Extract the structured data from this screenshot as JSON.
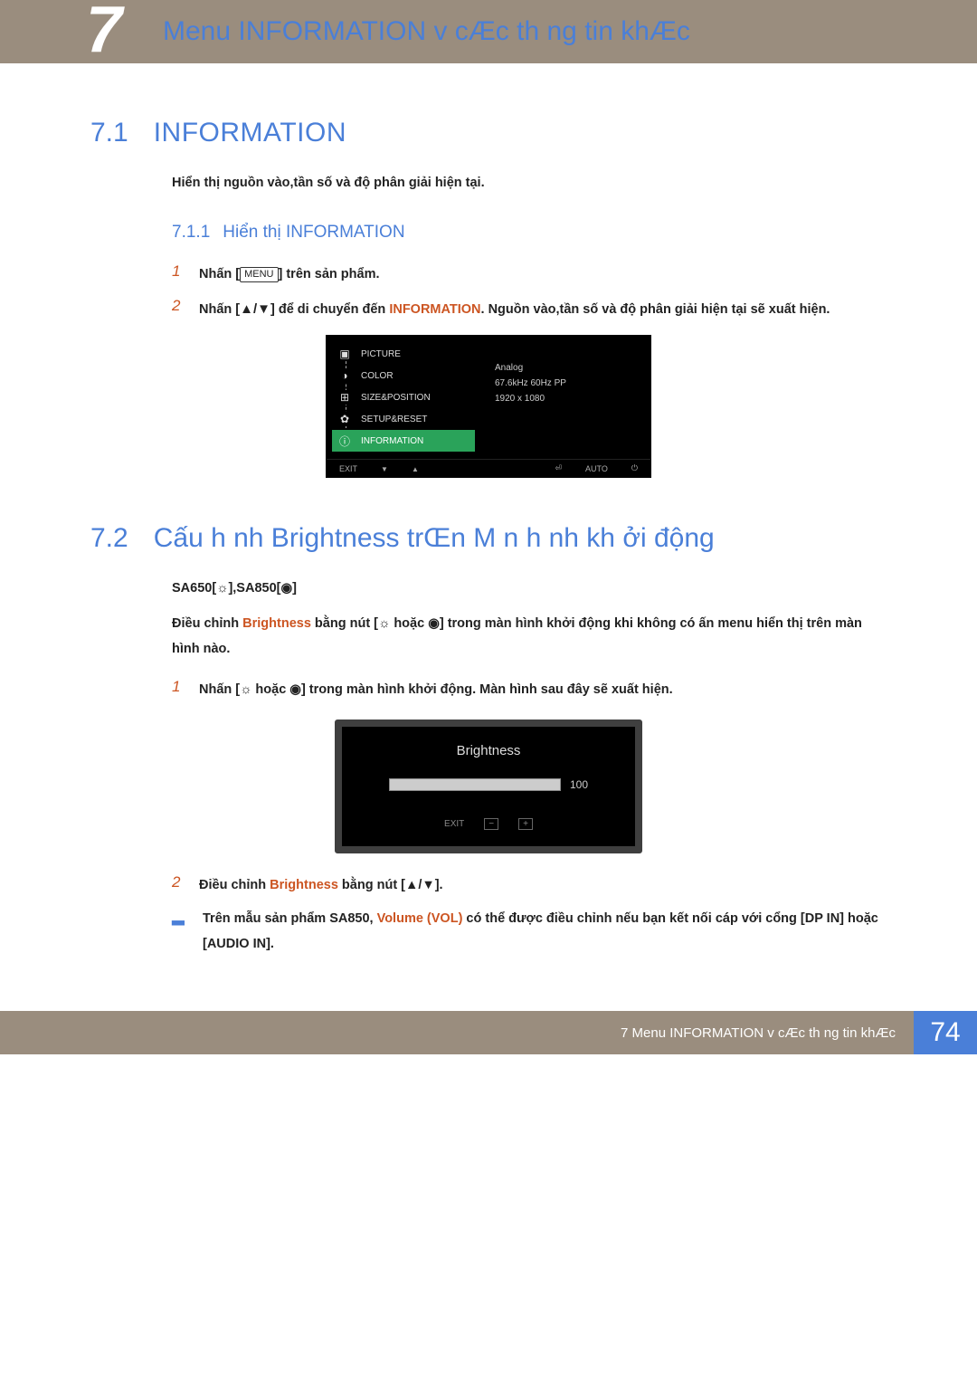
{
  "header": {
    "chapter_num": "7",
    "chapter_title": "Menu INFORMATION v  cÆc th ng tin khÆc"
  },
  "section71": {
    "num": "7.1",
    "title": "INFORMATION",
    "desc": "Hiển thị nguồn vào,tần số và độ phân giải hiện tại.",
    "sub": {
      "num": "7.1.1",
      "title": "Hiển thị INFORMATION"
    },
    "steps": {
      "s1": {
        "num": "1",
        "pre": "Nhấn [",
        "btn": "MENU",
        "post": "] trên sản phẩm."
      },
      "s2": {
        "num": "2",
        "pre": "Nhấn [",
        "updn": "▲/▼",
        "mid": "] để di chuyển đến ",
        "hl": "INFORMATION",
        "post": ". Nguồn vào,tần số và độ phân giải hiện tại sẽ xuất hiện."
      }
    }
  },
  "osd": {
    "items": [
      "PICTURE",
      "COLOR",
      "SIZE&POSITION",
      "SETUP&RESET",
      "INFORMATION"
    ],
    "info": [
      "Analog",
      "67.6kHz 60Hz PP",
      "1920 x 1080"
    ],
    "foot": {
      "exit": "EXIT",
      "auto": "AUTO"
    }
  },
  "section72": {
    "num": "7.2",
    "title": "Cấu h nh Brightness trŒn M n h nh kh    ởi động",
    "models": "SA650[☼],SA850[◉]",
    "desc_pre": "Điều chỉnh ",
    "desc_hl": "Brightness",
    "desc_mid": " bằng nút [☼ hoặc ◉] trong màn hình khởi động khi không có ấn menu hiển thị trên màn hình nào.",
    "steps": {
      "s1": {
        "num": "1",
        "text": "Nhấn [☼ hoặc ◉] trong màn hình khởi động. Màn hình sau đây sẽ xuất hiện."
      },
      "s2": {
        "num": "2",
        "pre": "Điều chỉnh ",
        "hl": "Brightness",
        "post": " bằng nút [▲/▼]."
      }
    },
    "note": {
      "pre": "Trên mẫu sản phẩm SA850, ",
      "hl": "Volume",
      "paren": " (VOL)",
      "post": " có thể được điều chỉnh nếu bạn kết nối cáp với cổng [DP IN] hoặc [AUDIO IN]."
    }
  },
  "brightness": {
    "title": "Brightness",
    "value": "100",
    "exit": "EXIT"
  },
  "footer": {
    "text": "7 Menu INFORMATION v  cÆc th ng tin khÆc",
    "page": "74"
  }
}
